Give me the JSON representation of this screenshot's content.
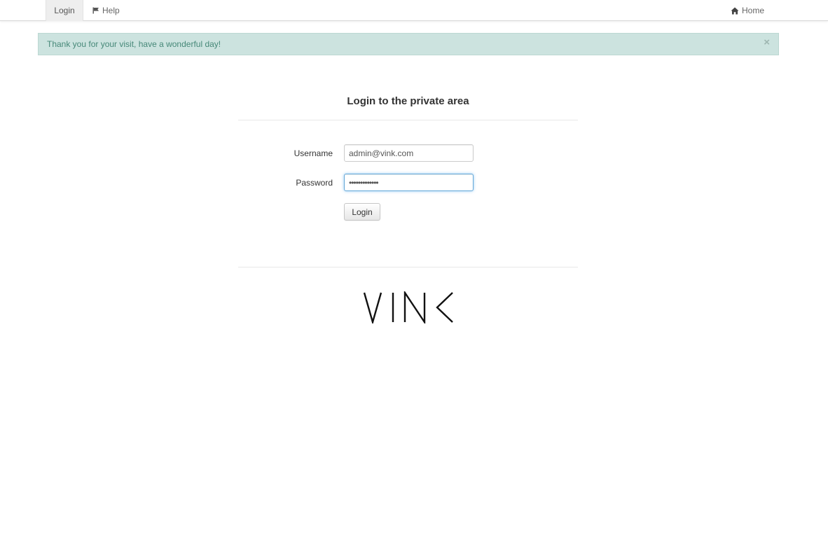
{
  "navbar": {
    "login_label": "Login",
    "help_label": "Help",
    "home_label": "Home"
  },
  "alert": {
    "message": "Thank you for your visit, have a wonderful day!",
    "close_symbol": "×"
  },
  "form": {
    "title": "Login to the private area",
    "username_label": "Username",
    "username_value": "admin@vink.com",
    "password_label": "Password",
    "password_value": "•••••••••••••",
    "submit_label": "Login"
  },
  "logo": {
    "text": "VINK"
  },
  "icons": {
    "help": "flag-icon",
    "home": "home-icon"
  },
  "colors": {
    "alert_background": "#cce3df",
    "alert_text": "#468878",
    "focus_border": "#66a9d9"
  }
}
